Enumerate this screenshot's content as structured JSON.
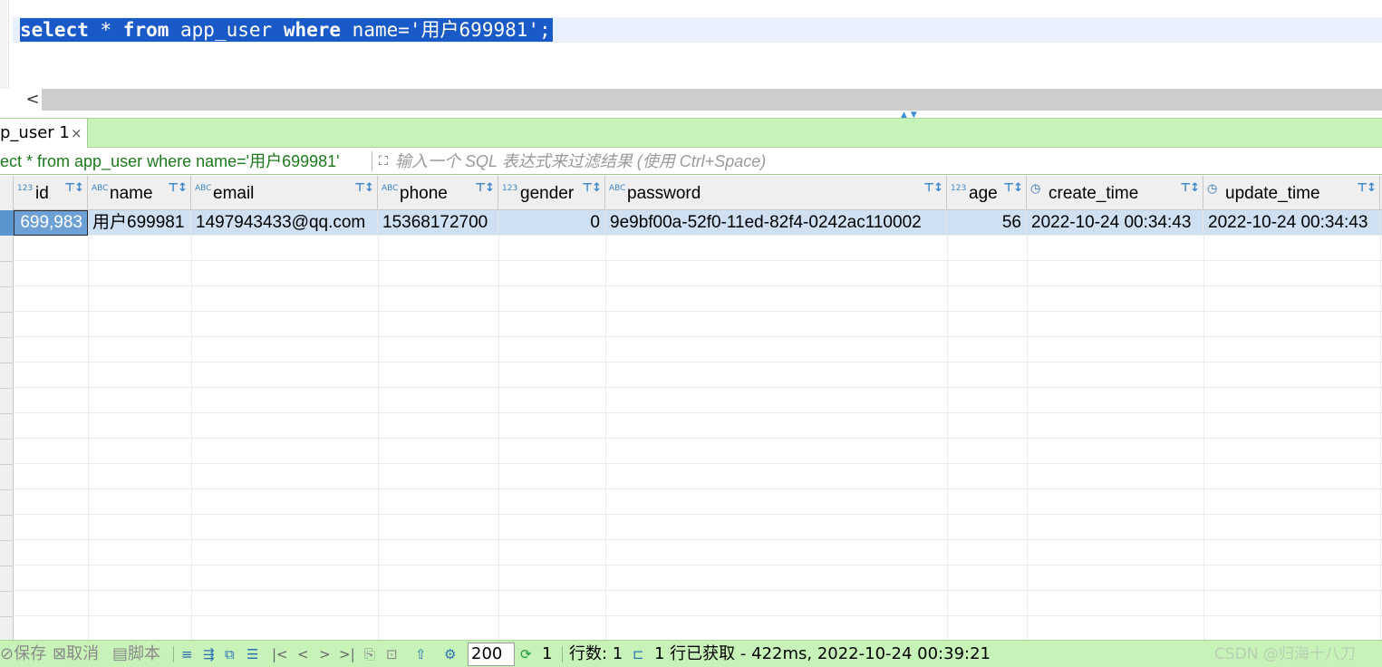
{
  "editor": {
    "sql_kw_select": "select",
    "sql_star": " * ",
    "sql_kw_from": "from",
    "sql_table": " app_user ",
    "sql_kw_where": "where",
    "sql_rest": " name='用户699981';"
  },
  "scrollbar": {
    "left_arrow": "<"
  },
  "result_tab": {
    "label": "p_user 1",
    "close": "×"
  },
  "filter": {
    "query_text": "ect * from app_user where name='用户699981'",
    "placeholder": "输入一个 SQL 表达式来过滤结果 (使用 Ctrl+Space)"
  },
  "columns": [
    {
      "name": "id",
      "type": "123"
    },
    {
      "name": "name",
      "type": "ABC"
    },
    {
      "name": "email",
      "type": "ABC"
    },
    {
      "name": "phone",
      "type": "ABC"
    },
    {
      "name": "gender",
      "type": "123"
    },
    {
      "name": "password",
      "type": "ABC"
    },
    {
      "name": "age",
      "type": "123"
    },
    {
      "name": "create_time",
      "type": "clock-icon"
    },
    {
      "name": "update_time",
      "type": "clock-icon"
    }
  ],
  "rows": [
    [
      "699,983",
      "用户699981",
      "1497943433@qq.com",
      "15368172700",
      "0",
      "9e9bf00a-52f0-11ed-82f4-0242ac110002",
      "56",
      "2022-10-24 00:34:43",
      "2022-10-24 00:34:43"
    ]
  ],
  "statusbar": {
    "save": "保存",
    "cancel": "取消",
    "script": "脚本",
    "fetch_size": "200",
    "refresh_count": "1",
    "row_count": "行数: 1",
    "fetch_info": "1 行已获取 - 422ms, 2022-10-24 00:39:21",
    "watermark": "CSDN @归海十八刀"
  }
}
